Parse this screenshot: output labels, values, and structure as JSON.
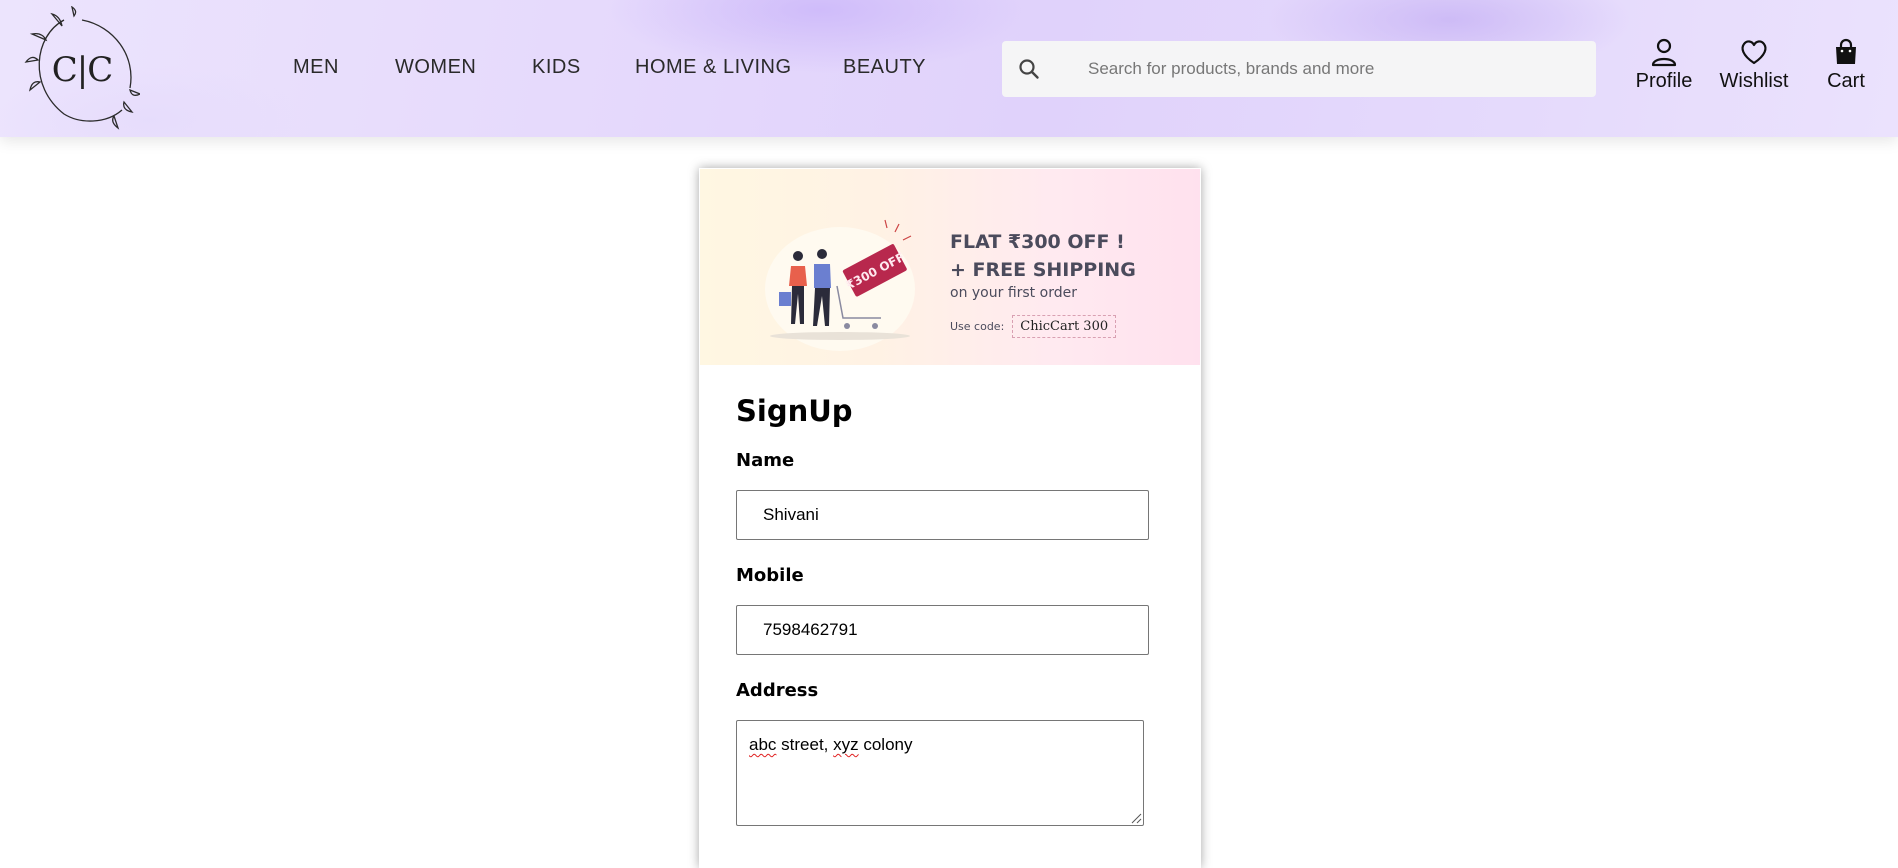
{
  "brand": {
    "logo_text": "C|C"
  },
  "nav": {
    "items": [
      {
        "label": "MEN"
      },
      {
        "label": "WOMEN"
      },
      {
        "label": "KIDS"
      },
      {
        "label": "HOME & LIVING"
      },
      {
        "label": "BEAUTY"
      }
    ]
  },
  "search": {
    "placeholder": "Search for products, brands and more",
    "icon": "search-icon"
  },
  "actions": {
    "profile": {
      "label": "Profile",
      "icon": "user-icon"
    },
    "wishlist": {
      "label": "Wishlist",
      "icon": "heart-icon"
    },
    "cart": {
      "label": "Cart",
      "icon": "shopping-bag-icon"
    }
  },
  "banner": {
    "line1": "FLAT ₹300 OFF !",
    "line2": "+ FREE SHIPPING",
    "line3": "on your first order",
    "code_label": "Use code:",
    "code": "ChicCart 300",
    "tag_text": "₹300 OFF"
  },
  "signup": {
    "title": "SignUp",
    "name_label": "Name",
    "name_value": "Shivani",
    "mobile_label": "Mobile",
    "mobile_value": "7598462791",
    "address_label": "Address",
    "address_value": {
      "w1": "abc",
      "w2": " street, ",
      "w3": "xyz",
      "w4": " colony"
    }
  },
  "colors": {
    "header_bg": "#e6dafc",
    "search_bg": "#f5f5f6",
    "promo_text": "#4b4b5c",
    "tag": "#b8284d"
  }
}
